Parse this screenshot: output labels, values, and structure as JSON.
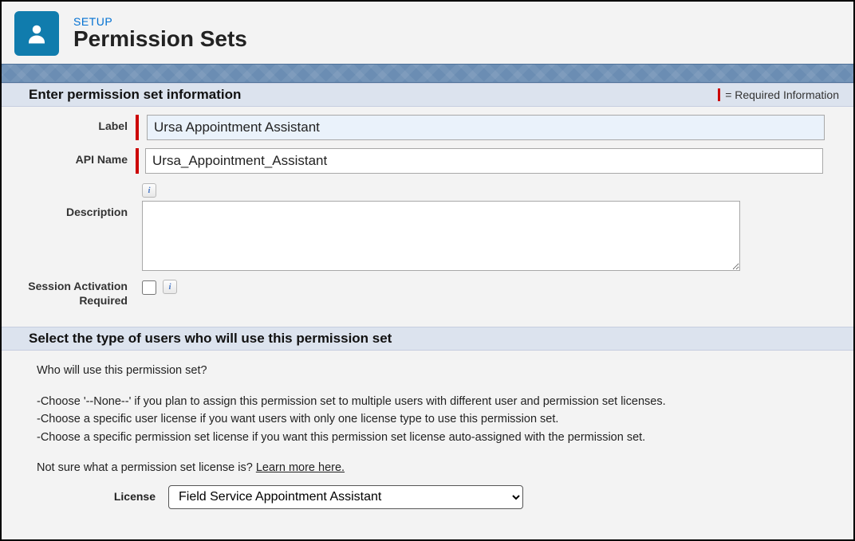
{
  "header": {
    "eyebrow": "SETUP",
    "title": "Permission Sets"
  },
  "legend": {
    "text": "= Required Information"
  },
  "section1": {
    "title": "Enter permission set information",
    "labels": {
      "label": "Label",
      "api_name": "API Name",
      "description": "Description",
      "session": "Session Activation Required"
    },
    "values": {
      "label": "Ursa Appointment Assistant",
      "api_name": "Ursa_Appointment_Assistant",
      "description": ""
    },
    "session_checked": false
  },
  "section2": {
    "title": "Select the type of users who will use this permission set",
    "intro": "Who will use this permission set?",
    "bullet1": "-Choose '--None--' if you plan to assign this permission set to multiple users with different user and permission set licenses.",
    "bullet2": "-Choose a specific user license if you want users with only one license type to use this permission set.",
    "bullet3": "-Choose a specific permission set license if you want this permission set license auto-assigned with the permission set.",
    "notsure": "Not sure what a permission set license is? ",
    "learn_more": "Learn more here.",
    "license_label": "License",
    "license_selected": "Field Service Appointment Assistant"
  }
}
